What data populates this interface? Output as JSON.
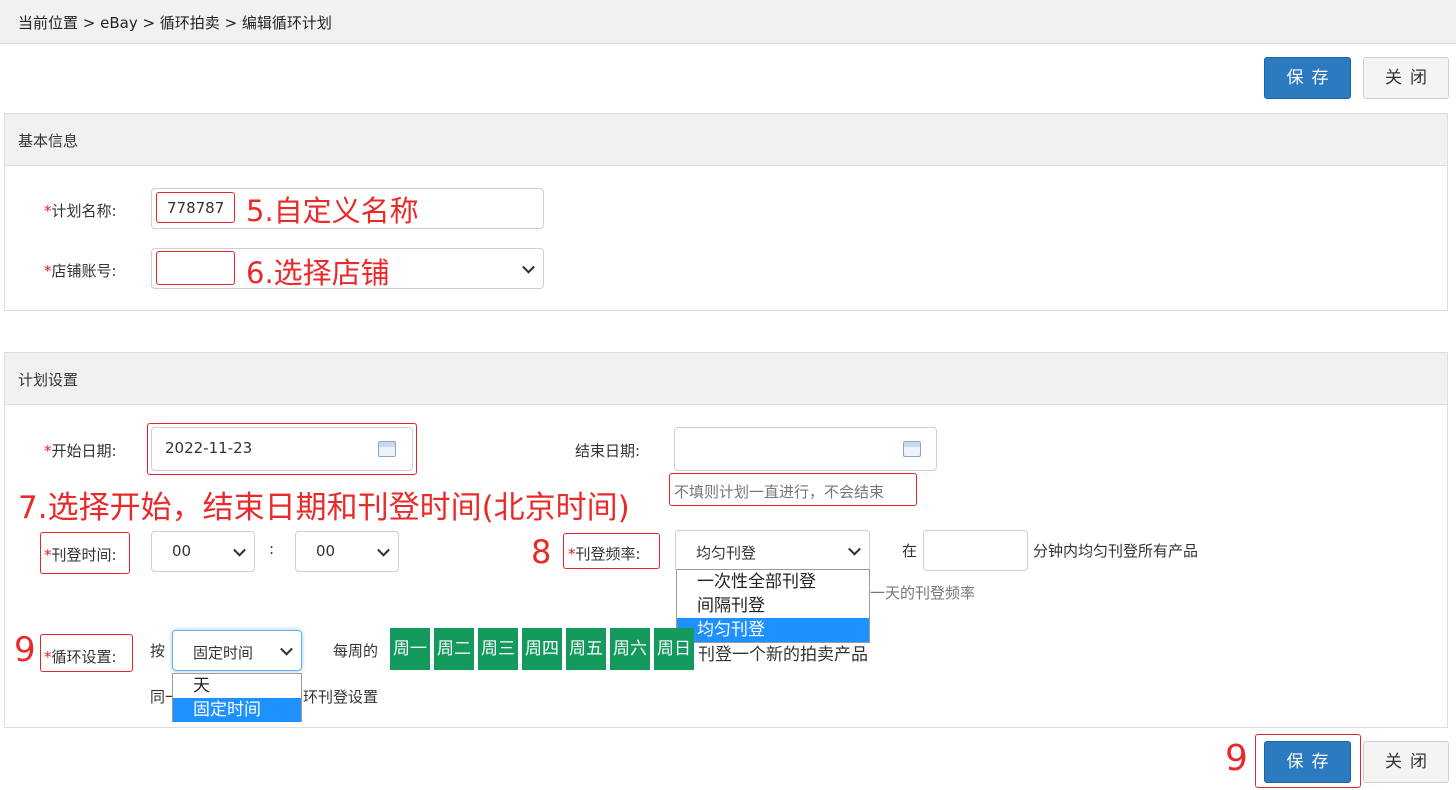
{
  "breadcrumb": "当前位置 > eBay > 循环拍卖 > 编辑循环计划",
  "toolbar": {
    "save_label": "保存",
    "close_label": "关闭"
  },
  "basic_info": {
    "title": "基本信息",
    "plan_name_label": "计划名称:",
    "plan_name_value": "778787",
    "store_label": "店铺账号:",
    "store_value": ""
  },
  "plan_settings": {
    "title": "计划设置",
    "start_date_label": "开始日期:",
    "start_date_value": "2022-11-23",
    "end_date_label": "结束日期:",
    "end_date_value": "",
    "end_date_hint": "不填则计划一直进行，不会结束",
    "publish_time_label": "刊登时间:",
    "publish_hour": "00",
    "time_separator": ":",
    "publish_minute": "00",
    "frequency_label": "刊登频率:",
    "frequency_value": "均匀刊登",
    "frequency_options": [
      "一次性全部刊登",
      "间隔刊登",
      "均匀刊登"
    ],
    "in_label": "在",
    "minutes_value": "",
    "minutes_suffix": "分钟内均匀刊登所有产品",
    "frequency_hint_partial": "一天的刊登频率",
    "cycle_label": "循环设置:",
    "by_label": "按",
    "cycle_value": "固定时间",
    "cycle_options": [
      "天",
      "固定时间"
    ],
    "weekly_prefix": "每周的",
    "weekdays": [
      "周一",
      "周二",
      "周三",
      "周四",
      "周五",
      "周六",
      "周日"
    ],
    "weekly_suffix": "刊登一个新的拍卖产品",
    "cycle_hint_left": "同一",
    "cycle_hint_right": "环刊登设置"
  },
  "annotations": {
    "a5": "5.自定义名称",
    "a6": "6.选择店铺",
    "a7": "7.选择开始，结束日期和刊登时间(北京时间)",
    "a8": "8",
    "a9_cycle": "9",
    "a9_save": "9"
  },
  "colors": {
    "primary": "#2c7bc0",
    "weekday_green": "#139a5c",
    "annotation_red": "#ea2a2a",
    "required_red": "#e02020"
  }
}
